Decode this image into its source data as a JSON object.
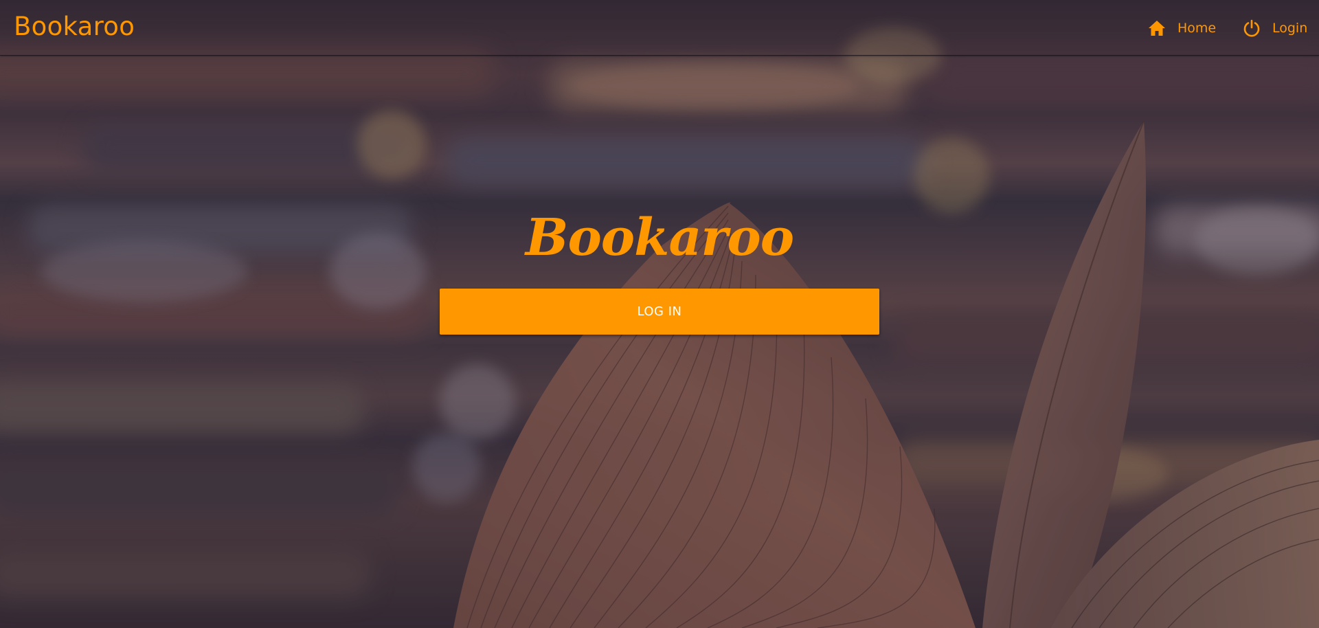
{
  "navbar": {
    "brand": "Bookaroo",
    "items": [
      {
        "label": "Home",
        "icon": "home-icon"
      },
      {
        "label": "Login",
        "icon": "power-icon"
      }
    ]
  },
  "hero": {
    "title": "Bookaroo",
    "login_button_label": "LOG IN"
  },
  "colors": {
    "accent": "#ff9800",
    "button_text": "#ffffff"
  }
}
